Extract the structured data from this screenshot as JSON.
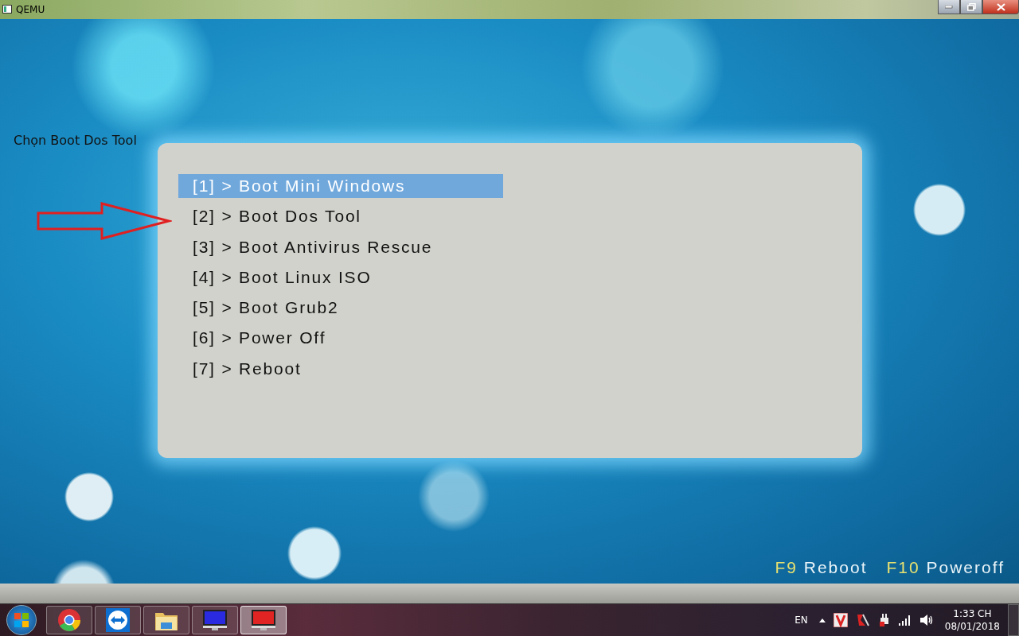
{
  "window": {
    "title": "QEMU"
  },
  "annotation": {
    "text": "Chọn Boot Dos Tool"
  },
  "menu": {
    "items": [
      {
        "label": "[1] > Boot Mini Windows",
        "selected": true
      },
      {
        "label": "[2] > Boot Dos Tool",
        "selected": false
      },
      {
        "label": "[3] > Boot Antivirus Rescue",
        "selected": false
      },
      {
        "label": "[4] > Boot Linux ISO",
        "selected": false
      },
      {
        "label": "[5] > Boot Grub2",
        "selected": false
      },
      {
        "label": "[6] > Power Off",
        "selected": false
      },
      {
        "label": "[7] > Reboot",
        "selected": false
      }
    ]
  },
  "hotkeys": [
    {
      "key": "F9",
      "action": "Reboot"
    },
    {
      "key": "F10",
      "action": "Poweroff"
    }
  ],
  "taskbar": {
    "apps": [
      {
        "kind": "browser",
        "selected": false
      },
      {
        "kind": "remote",
        "selected": false
      },
      {
        "kind": "folder",
        "selected": false
      },
      {
        "kind": "monitor",
        "color": "#2a2ae0",
        "selected": false
      },
      {
        "kind": "monitor",
        "color": "#e02424",
        "selected": true
      }
    ],
    "language": "EN",
    "time": "1:33 CH",
    "date": "08/01/2018"
  }
}
